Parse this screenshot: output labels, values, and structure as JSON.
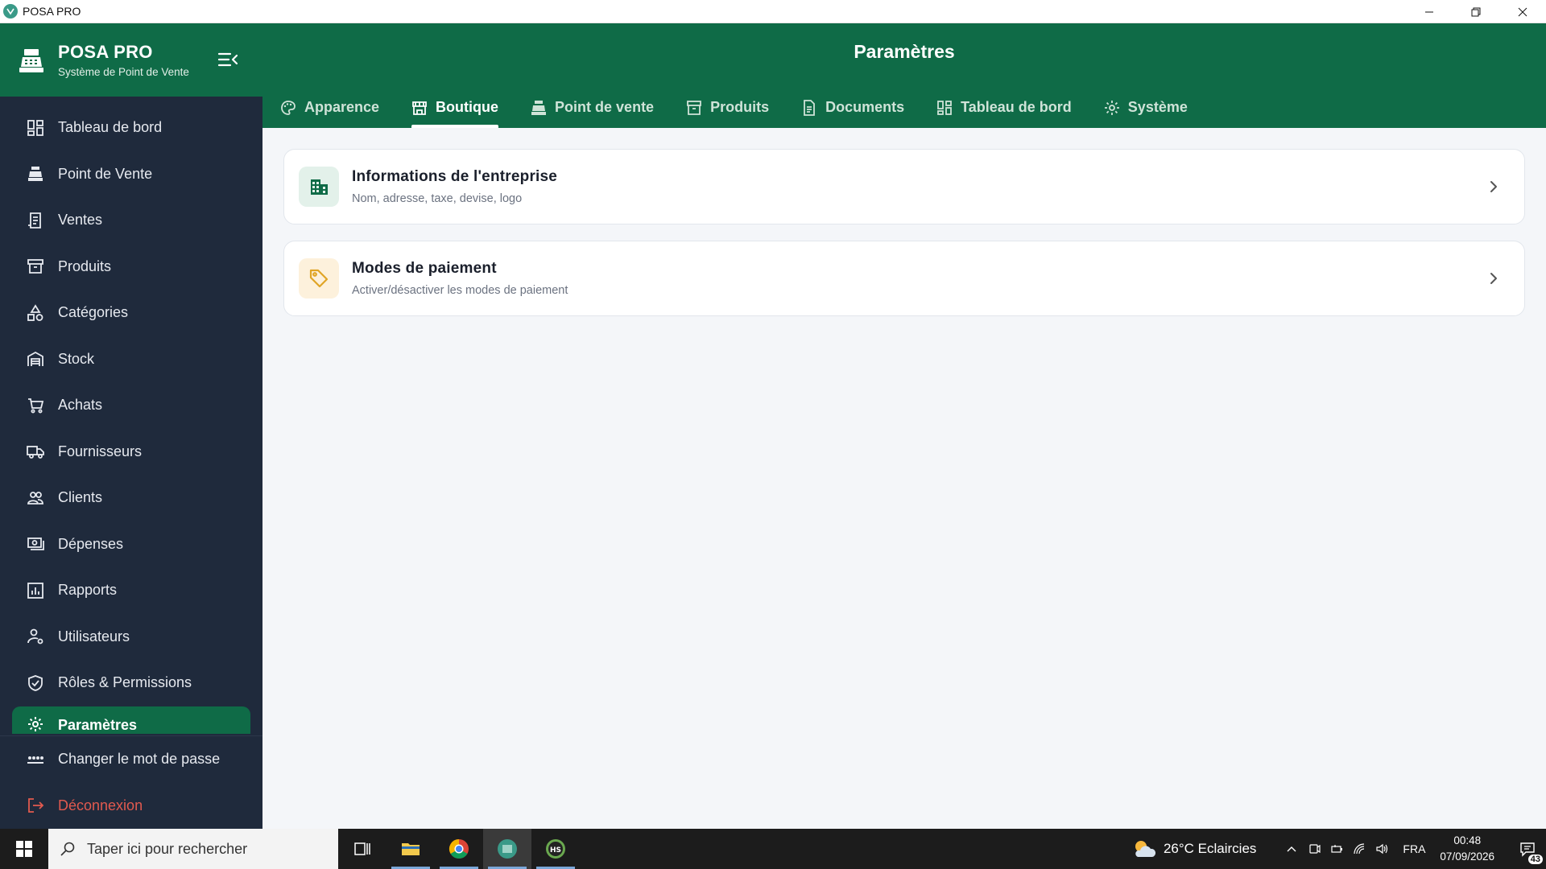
{
  "window": {
    "title": "POSA PRO"
  },
  "brand": {
    "title": "POSA PRO",
    "subtitle": "Système de Point de Vente"
  },
  "sidebar": {
    "items": [
      {
        "label": "Tableau de bord",
        "icon": "dashboard-icon"
      },
      {
        "label": "Point de Vente",
        "icon": "cash-register-icon"
      },
      {
        "label": "Ventes",
        "icon": "receipt-icon"
      },
      {
        "label": "Produits",
        "icon": "archive-icon"
      },
      {
        "label": "Catégories",
        "icon": "shapes-icon"
      },
      {
        "label": "Stock",
        "icon": "warehouse-icon"
      },
      {
        "label": "Achats",
        "icon": "cart-icon"
      },
      {
        "label": "Fournisseurs",
        "icon": "truck-icon"
      },
      {
        "label": "Clients",
        "icon": "users-icon"
      },
      {
        "label": "Dépenses",
        "icon": "money-icon"
      },
      {
        "label": "Rapports",
        "icon": "bar-chart-icon"
      },
      {
        "label": "Utilisateurs",
        "icon": "user-gear-icon"
      },
      {
        "label": "Rôles & Permissions",
        "icon": "shield-check-icon"
      },
      {
        "label": "Paramètres",
        "icon": "gear-icon",
        "active": true
      }
    ],
    "bottom": [
      {
        "label": "Changer le mot de passe",
        "icon": "password-icon"
      },
      {
        "label": "Déconnexion",
        "icon": "logout-icon"
      }
    ]
  },
  "header": {
    "title": "Paramètres",
    "tabs": [
      {
        "label": "Apparence",
        "icon": "palette-icon"
      },
      {
        "label": "Boutique",
        "icon": "store-icon",
        "active": true
      },
      {
        "label": "Point de vente",
        "icon": "cash-register-icon"
      },
      {
        "label": "Produits",
        "icon": "archive-icon"
      },
      {
        "label": "Documents",
        "icon": "document-icon"
      },
      {
        "label": "Tableau de bord",
        "icon": "dashboard-icon"
      },
      {
        "label": "Système",
        "icon": "gear-icon"
      }
    ]
  },
  "cards": [
    {
      "title": "Informations de l'entreprise",
      "subtitle": "Nom, adresse, taxe, devise, logo",
      "icon": "building-icon",
      "icon_color": "#0f6b47",
      "icon_bg": "#e3f1ea"
    },
    {
      "title": "Modes de paiement",
      "subtitle": "Activer/désactiver les modes de paiement",
      "icon": "tag-icon",
      "icon_color": "#e0a526",
      "icon_bg": "#fdf1dc"
    }
  ],
  "colors": {
    "primary": "#0f6b47",
    "sidebar_bg": "#1f2a3c",
    "danger": "#e25a4f"
  },
  "taskbar": {
    "search_placeholder": "Taper ici pour rechercher",
    "weather": "26°C  Eclaircies",
    "language": "FRA",
    "time": "00:48",
    "date": "07/09/2026",
    "notifications": "43"
  }
}
